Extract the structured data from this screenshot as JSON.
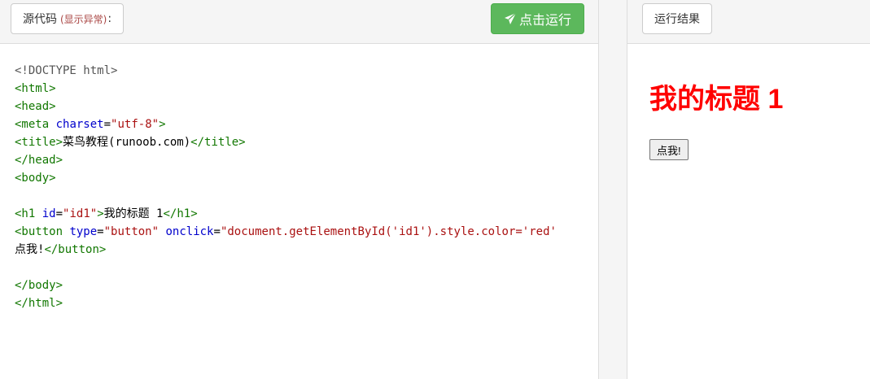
{
  "editor": {
    "source_label": "源代码",
    "source_note": "(显示异常)",
    "source_colon": ":",
    "run_button_label": "点击运行",
    "run_icon": "paper-plane-icon",
    "code_lines": [
      [
        {
          "t": "meta",
          "v": "<!DOCTYPE html>"
        }
      ],
      [
        {
          "t": "tag",
          "v": "<html>"
        }
      ],
      [
        {
          "t": "tag",
          "v": "<head>"
        }
      ],
      [
        {
          "t": "tag",
          "v": "<meta"
        },
        {
          "t": "txt",
          "v": " "
        },
        {
          "t": "attr",
          "v": "charset"
        },
        {
          "t": "txt",
          "v": "="
        },
        {
          "t": "str",
          "v": "\"utf-8\""
        },
        {
          "t": "tag",
          "v": ">"
        }
      ],
      [
        {
          "t": "tag",
          "v": "<title>"
        },
        {
          "t": "txt",
          "v": "菜鸟教程(runoob.com)"
        },
        {
          "t": "tag",
          "v": "</title>"
        }
      ],
      [
        {
          "t": "tag",
          "v": "</head>"
        }
      ],
      [
        {
          "t": "tag",
          "v": "<body>"
        }
      ],
      [],
      [
        {
          "t": "tag",
          "v": "<h1"
        },
        {
          "t": "txt",
          "v": " "
        },
        {
          "t": "attr",
          "v": "id"
        },
        {
          "t": "txt",
          "v": "="
        },
        {
          "t": "str",
          "v": "\"id1\""
        },
        {
          "t": "tag",
          "v": ">"
        },
        {
          "t": "txt",
          "v": "我的标题 1"
        },
        {
          "t": "tag",
          "v": "</h1>"
        }
      ],
      [
        {
          "t": "tag",
          "v": "<button"
        },
        {
          "t": "txt",
          "v": " "
        },
        {
          "t": "attr",
          "v": "type"
        },
        {
          "t": "txt",
          "v": "="
        },
        {
          "t": "str",
          "v": "\"button\""
        },
        {
          "t": "txt",
          "v": " "
        },
        {
          "t": "attr",
          "v": "onclick"
        },
        {
          "t": "txt",
          "v": "="
        },
        {
          "t": "str",
          "v": "\"document.getElementById('id1').style.color='red'"
        }
      ],
      [
        {
          "t": "txt",
          "v": "点我!"
        },
        {
          "t": "tag",
          "v": "</button>"
        }
      ],
      [],
      [
        {
          "t": "tag",
          "v": "</body>"
        }
      ],
      [
        {
          "t": "tag",
          "v": "</html>"
        }
      ]
    ]
  },
  "result": {
    "label": "运行结果",
    "heading": "我的标题 1",
    "heading_color": "#ff0000",
    "button_label": "点我!"
  },
  "colors": {
    "run_button": "#5cb85c",
    "tag": "#117700",
    "attr": "#0000cc",
    "string": "#aa1111"
  }
}
